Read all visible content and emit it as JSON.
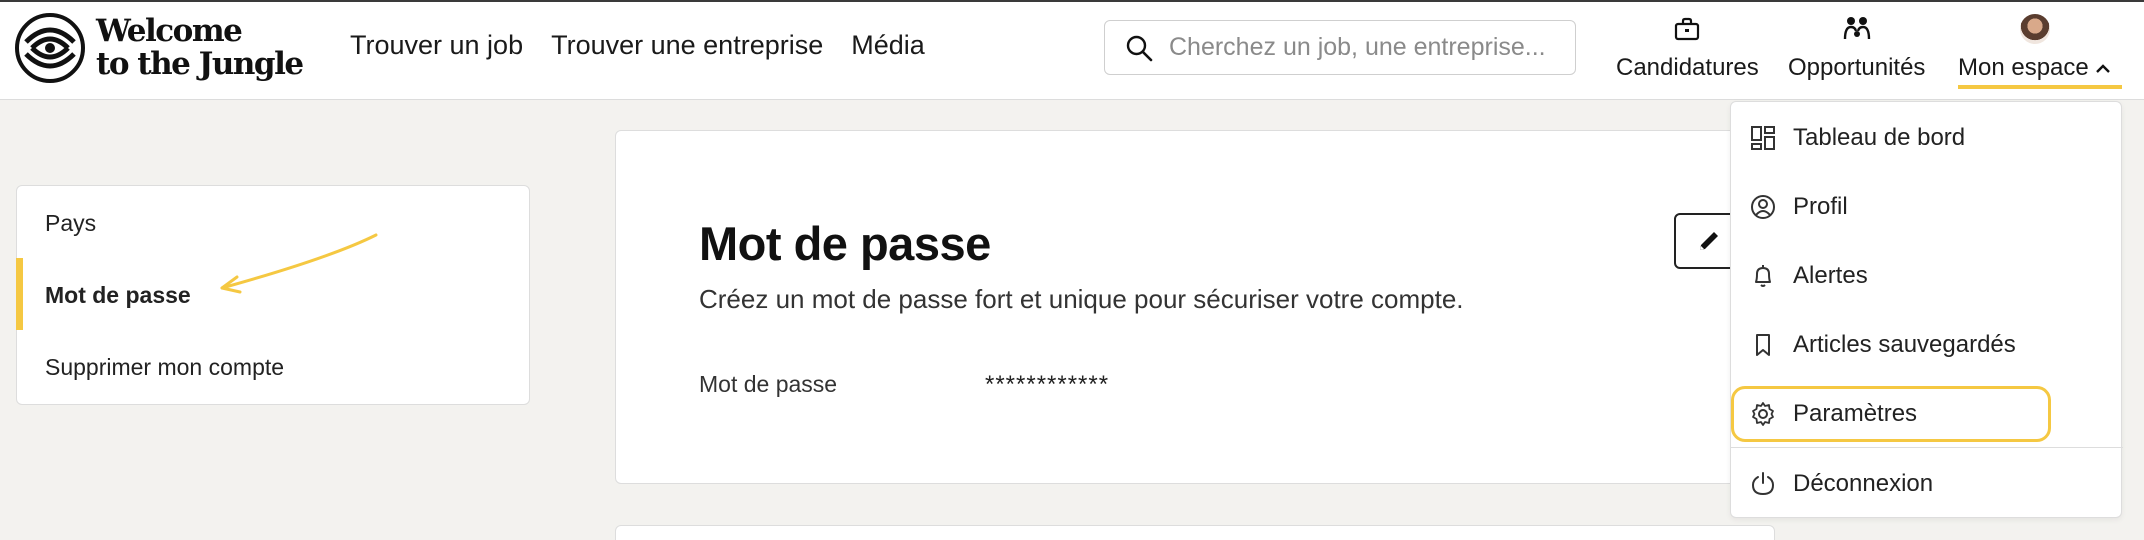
{
  "brand": {
    "logo_line1": "Welcome",
    "logo_line2": "to the Jungle",
    "accent_color": "#f5c842"
  },
  "nav": {
    "links": [
      "Trouver un job",
      "Trouver une entreprise",
      "Média"
    ]
  },
  "search": {
    "placeholder": "Cherchez un job, une entreprise..."
  },
  "header_actions": {
    "candidatures": "Candidatures",
    "opportunites": "Opportunités",
    "mon_espace": "Mon espace"
  },
  "sidebar": {
    "items": [
      {
        "label": "Pays"
      },
      {
        "label": "Mot de passe"
      },
      {
        "label": "Supprimer mon compte"
      }
    ],
    "active_index": 1
  },
  "card": {
    "title": "Mot de passe",
    "subtitle": "Créez un mot de passe fort et unique pour sécuriser votre compte.",
    "field_label": "Mot de passe",
    "field_value": "************"
  },
  "dropdown": {
    "items": [
      {
        "label": "Tableau de bord",
        "icon": "dashboard-icon"
      },
      {
        "label": "Profil",
        "icon": "profile-icon"
      },
      {
        "label": "Alertes",
        "icon": "bell-icon"
      },
      {
        "label": "Articles sauvegardés",
        "icon": "bookmark-icon"
      },
      {
        "label": "Paramètres",
        "icon": "gear-icon"
      },
      {
        "label": "Déconnexion",
        "icon": "power-icon"
      }
    ],
    "highlighted": "Paramètres"
  }
}
